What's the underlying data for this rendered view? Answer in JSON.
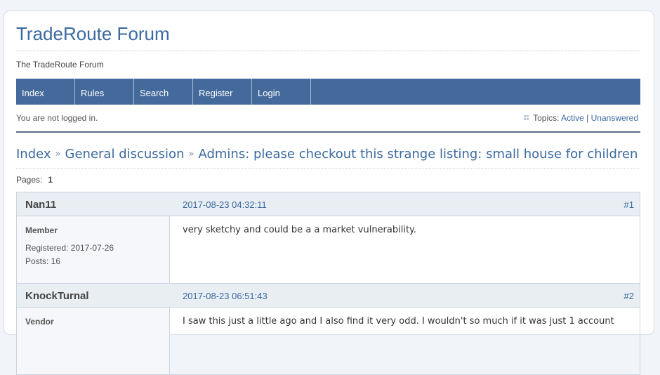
{
  "site": {
    "title": "TradeRoute Forum",
    "description": "The TradeRoute Forum"
  },
  "nav": {
    "items": [
      "Index",
      "Rules",
      "Search",
      "Register",
      "Login"
    ]
  },
  "status": {
    "login_text": "You are not logged in.",
    "topics_label": "Topics:",
    "active_link": "Active",
    "separator": "|",
    "unanswered_link": "Unanswered"
  },
  "breadcrumb": {
    "index": "Index",
    "forum": "General discussion",
    "topic": "Admins: please checkout this strange listing: small house for children",
    "sep": "»"
  },
  "pagination": {
    "label": "Pages:",
    "current": "1"
  },
  "posts": [
    {
      "author": "Nan11",
      "date": "2017-08-23 04:32:11",
      "number": "#1",
      "role": "Member",
      "registered": "Registered: 2017-07-26",
      "post_count": "Posts: 16",
      "message": "very sketchy and could be a a market vulnerability."
    },
    {
      "author": "KnockTurnal",
      "date": "2017-08-23 06:51:43",
      "number": "#2",
      "role": "Vendor",
      "message": "I saw this just a little ago and I also find it very odd. I wouldn't so much if it was just 1 account"
    }
  ]
}
